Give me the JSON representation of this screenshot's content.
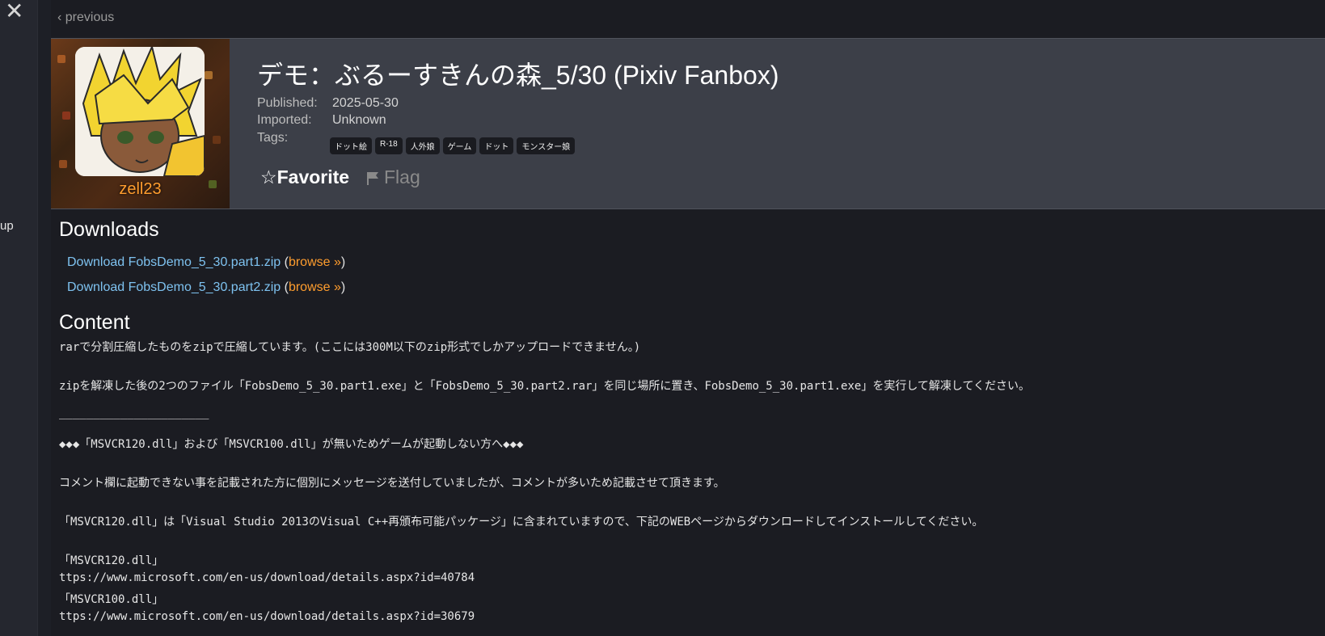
{
  "sidebar": {
    "close_glyph": "✕",
    "partial_text": "up"
  },
  "nav": {
    "previous_label": "‹ previous"
  },
  "post": {
    "user": "zell23",
    "title": "デモ：ぶるーすきんの森_5/30 (Pixiv Fanbox)",
    "published_label": "Published:",
    "published_value": "2025-05-30",
    "imported_label": "Imported:",
    "imported_value": "Unknown",
    "tags_label": "Tags:",
    "tags": [
      "ドット絵",
      "R-18",
      "人外娘",
      "ゲーム",
      "ドット",
      "モンスター娘"
    ],
    "favorite_label": "☆Favorite",
    "flag_label": "Flag"
  },
  "downloads": {
    "heading": "Downloads",
    "items": [
      {
        "link": "Download FobsDemo_5_30.part1.zip",
        "browse": "browse »"
      },
      {
        "link": "Download FobsDemo_5_30.part2.zip",
        "browse": "browse »"
      }
    ],
    "paren_open": "(",
    "paren_close": ")"
  },
  "content": {
    "heading": "Content",
    "lines": [
      "rarで分割圧縮したものをzipで圧縮しています。(ここには300M以下のzip形式でしかアップロードできません。)",
      "zipを解凍した後の2つのファイル「FobsDemo_5_30.part1.exe」と「FobsDemo_5_30.part2.rar」を同じ場所に置き、FobsDemo_5_30.part1.exe」を実行して解凍してください。",
      "______________________",
      "◆◆◆「MSVCR120.dll」および「MSVCR100.dll」が無いためゲームが起動しない方へ◆◆◆",
      "コメント欄に起動できない事を記載された方に個別にメッセージを送付していましたが、コメントが多いため記載させて頂きます。",
      "「MSVCR120.dll」は「Visual Studio 2013のVisual C++再頒布可能パッケージ」に含まれていますので、下記のWEBページからダウンロードしてインストールしてください。",
      "「MSVCR120.dll」",
      "ttps://www.microsoft.com/en-us/download/details.aspx?id=40784",
      "「MSVCR100.dll」",
      "ttps://www.microsoft.com/en-us/download/details.aspx?id=30679"
    ]
  },
  "colors": {
    "link": "#7ec2f0",
    "accent": "#ff9d2e",
    "header_bg": "#3c3f48"
  }
}
